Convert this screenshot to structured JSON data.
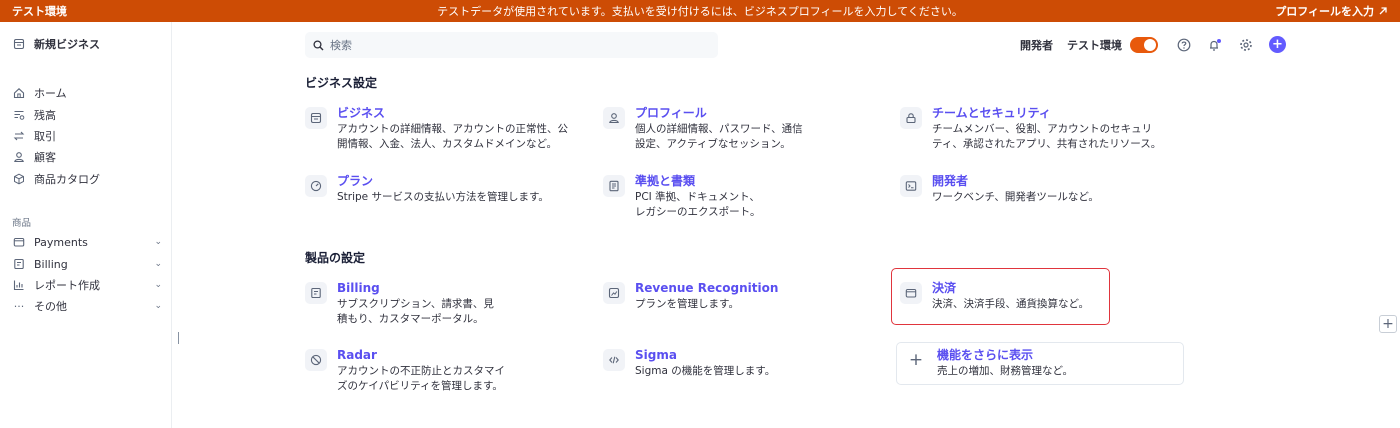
{
  "banner": {
    "env_label": "テスト環境",
    "message": "テストデータが使用されています。支払いを受け付けるには、ビジネスプロフィールを入力してください。",
    "action_label": "プロフィールを入力",
    "action_icon": "arrow-up-right-icon",
    "color": "#cd4c05"
  },
  "sidebar": {
    "account_name": "新規ビジネス",
    "items": [
      {
        "label": "ホーム",
        "icon": "home-icon"
      },
      {
        "label": "残高",
        "icon": "balance-icon"
      },
      {
        "label": "取引",
        "icon": "transactions-icon"
      },
      {
        "label": "顧客",
        "icon": "customer-icon"
      },
      {
        "label": "商品カタログ",
        "icon": "box-icon"
      }
    ],
    "products_heading": "商品",
    "product_items": [
      {
        "label": "Payments",
        "icon": "wallet-icon"
      },
      {
        "label": "Billing",
        "icon": "billing-icon"
      },
      {
        "label": "レポート作成",
        "icon": "chart-icon"
      },
      {
        "label": "その他",
        "icon": "more-icon"
      }
    ]
  },
  "search": {
    "placeholder": "検索"
  },
  "header": {
    "developers_label": "開発者",
    "test_mode_label": "テスト環境",
    "accent": "#635bff"
  },
  "business_settings": {
    "title": "ビジネス設定",
    "cards": [
      {
        "title": "ビジネス",
        "desc1": "アカウントの詳細情報、アカウントの正常性、公",
        "desc2": "開情報、入金、法人、カスタムドメインなど。"
      },
      {
        "title": "プロフィール",
        "desc1": "個人の詳細情報、パスワード、通信",
        "desc2": "設定、アクティブなセッション。"
      },
      {
        "title": "チームとセキュリティ",
        "desc1": "チームメンバー、役割、アカウントのセキュリ",
        "desc2": "ティ、承認されたアプリ、共有されたリソース。"
      },
      {
        "title": "プラン",
        "desc1": "Stripe サービスの支払い方法を管理します。",
        "desc2": ""
      },
      {
        "title": "準拠と書類",
        "desc1": "PCI 準拠、ドキュメント、",
        "desc2": "レガシーのエクスポート。"
      },
      {
        "title": "開発者",
        "desc1": "ワークベンチ、開発者ツールなど。",
        "desc2": ""
      }
    ]
  },
  "product_settings": {
    "title": "製品の設定",
    "cards": [
      {
        "title": "Billing",
        "desc1": "サブスクリプション、請求書、見",
        "desc2": "積もり、カスタマーポータル。"
      },
      {
        "title": "Revenue Recognition",
        "desc1": "プランを管理します。",
        "desc2": ""
      },
      {
        "title": "決済",
        "desc1": "決済、決済手段、通貨換算など。",
        "desc2": ""
      },
      {
        "title": "Radar",
        "desc1": "アカウントの不正防止とカスタマイ",
        "desc2": "ズのケイパビリティを管理します。"
      },
      {
        "title": "Sigma",
        "desc1": "Sigma の機能を管理します。",
        "desc2": ""
      },
      {
        "title": "機能をさらに表示",
        "desc1": "売上の増加、財務管理など。",
        "desc2": ""
      }
    ]
  }
}
